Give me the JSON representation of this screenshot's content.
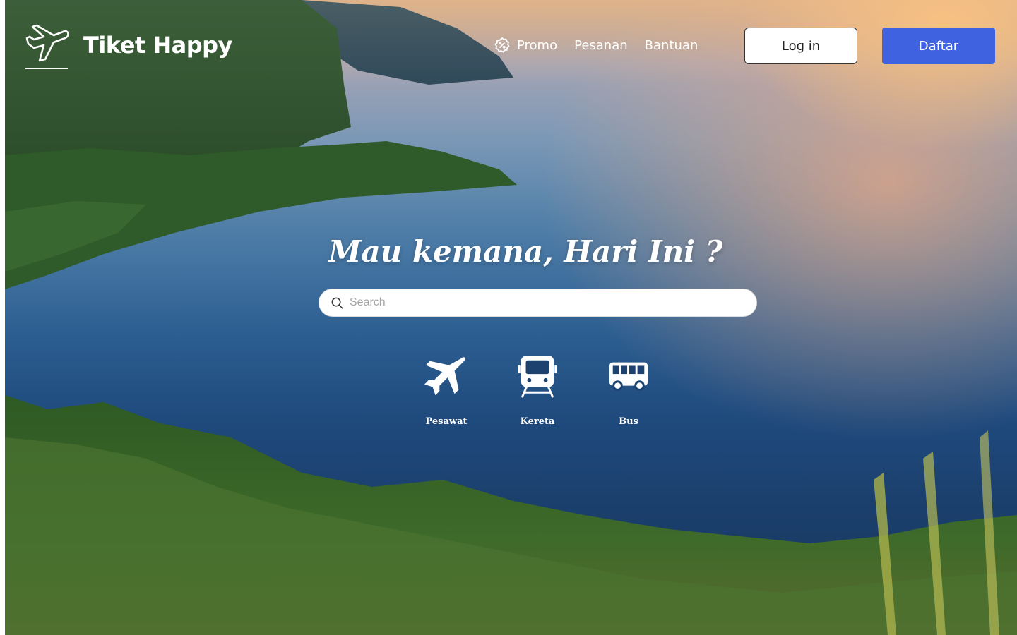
{
  "brand": {
    "name": "Tiket Happy",
    "icon": "airplane-takeoff-icon"
  },
  "nav": {
    "items": [
      {
        "label": "Promo",
        "icon": "badge-percent-icon"
      },
      {
        "label": "Pesanan"
      },
      {
        "label": "Bantuan"
      }
    ],
    "login_label": "Log in",
    "signup_label": "Daftar"
  },
  "hero": {
    "headline": "Mau kemana, Hari Ini ?",
    "search": {
      "placeholder": "Search",
      "value": ""
    }
  },
  "transport": [
    {
      "label": "Pesawat",
      "icon": "airplane-icon"
    },
    {
      "label": "Kereta",
      "icon": "train-icon"
    },
    {
      "label": "Bus",
      "icon": "bus-icon"
    }
  ],
  "colors": {
    "primary": "#3f63e0",
    "text_on_hero": "#ffffff"
  }
}
